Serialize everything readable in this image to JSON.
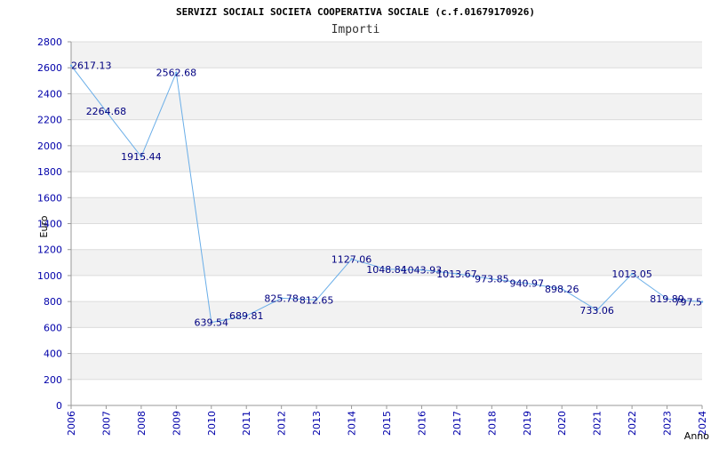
{
  "chart_data": {
    "type": "line",
    "title": "SERVIZI SOCIALI SOCIETA COOPERATIVA SOCIALE (c.f.01679170926)",
    "subtitle": "Importi",
    "xlabel": "Anno",
    "ylabel": "Euro",
    "ylim": [
      0,
      2800
    ],
    "ytick_step": 200,
    "grid": true,
    "categories": [
      "2006",
      "2007",
      "2008",
      "2009",
      "2010",
      "2011",
      "2012",
      "2013",
      "2014",
      "2015",
      "2016",
      "2017",
      "2018",
      "2019",
      "2020",
      "2021",
      "2022",
      "2023",
      "2024"
    ],
    "series": [
      {
        "values": [
          2617.13,
          2264.68,
          1915.44,
          2562.68,
          639.54,
          689.81,
          825.78,
          812.65,
          1127.06,
          1048.84,
          1043.93,
          1013.67,
          973.85,
          940.97,
          898.26,
          733.06,
          1013.05,
          819.89,
          797.5
        ],
        "labels": [
          "2617.13",
          "2264.68",
          "1915.44",
          "2562.68",
          "639.54",
          "689.81",
          "825.78",
          "812.65",
          "1127.06",
          "1048.84",
          "1043.93",
          "1013.67",
          "973.85",
          "940.97",
          "898.26",
          "733.06",
          "1013.05",
          "819.89",
          "797.5"
        ]
      }
    ]
  },
  "colors": {
    "line": "#6aaee8",
    "axis_text": "#0000aa",
    "band": "#f2f2f2",
    "grid": "#dcdcdc",
    "axis": "#999999"
  }
}
